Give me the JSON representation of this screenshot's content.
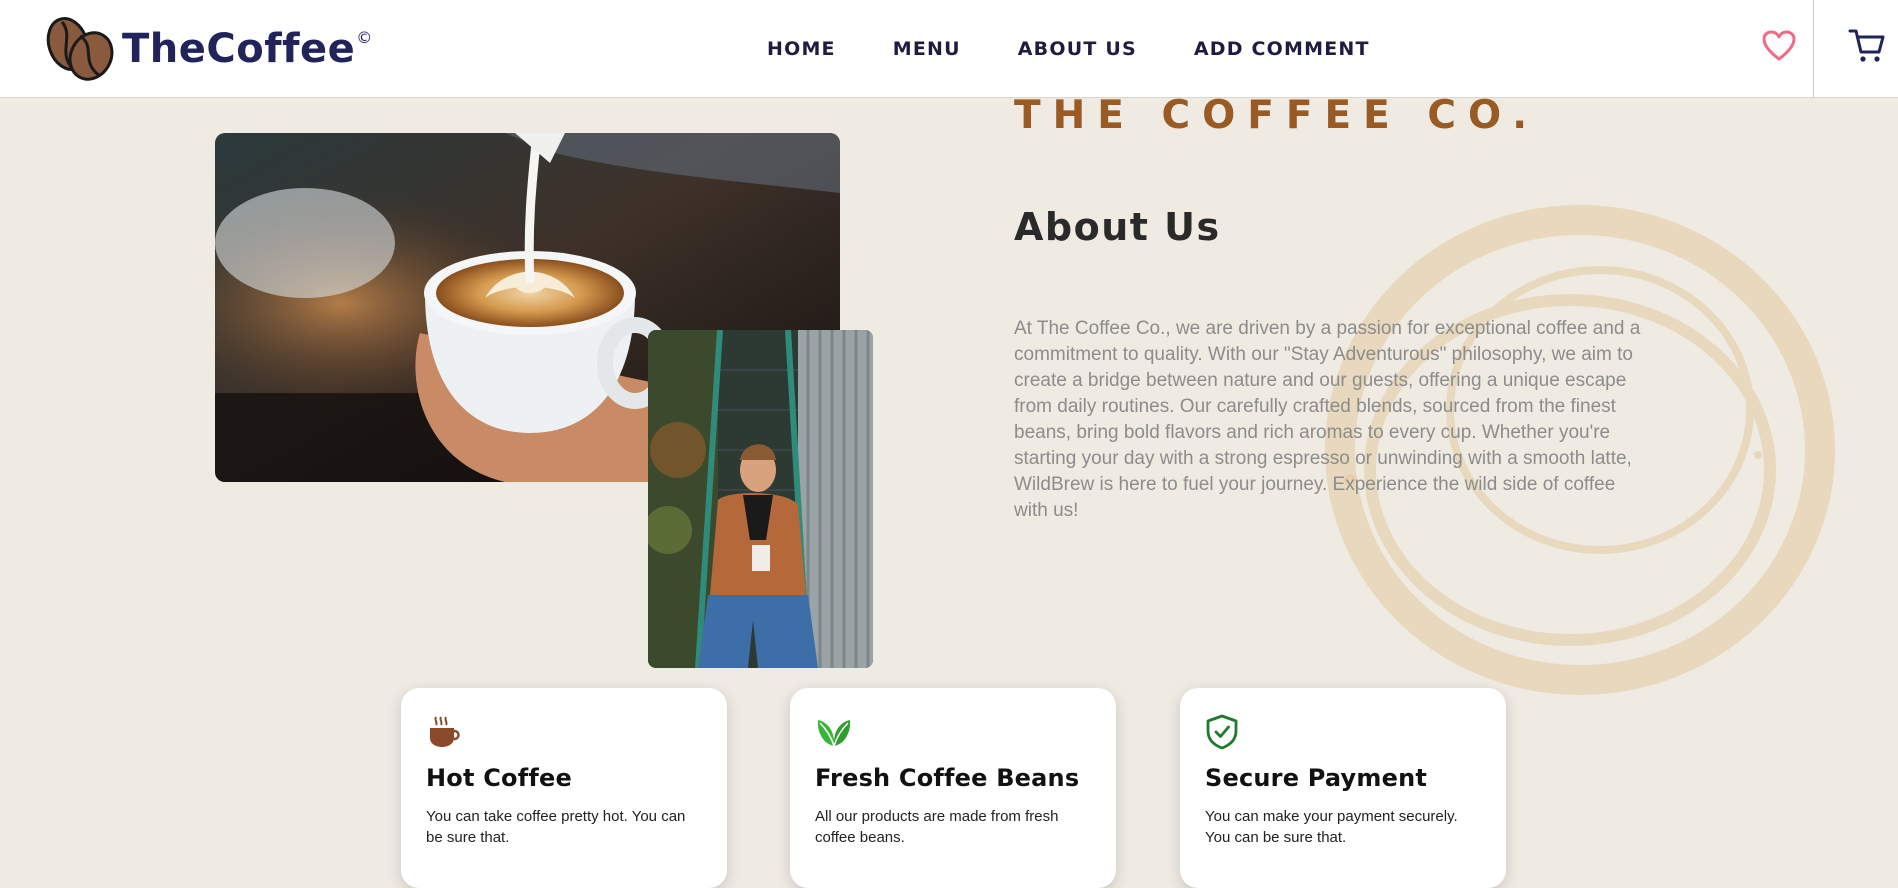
{
  "header": {
    "brand": "TheCoffee",
    "brand_mark": "©",
    "logo_icon": "coffee-beans-logo-icon",
    "nav": [
      "HOME",
      "MENU",
      "ABOUT US",
      "ADD COMMENT"
    ],
    "wishlist_icon": "heart-icon",
    "cart_icon": "cart-icon"
  },
  "about": {
    "eyebrow": "THE COFFEE CO.",
    "title": "About Us",
    "description": "At The Coffee Co., we are driven by a passion for exceptional coffee and a commitment to quality. With our \"Stay Adventurous\" philosophy, we aim to create a bridge between nature and our guests, offering a unique escape from daily routines. Our carefully crafted blends, sourced from the finest beans, bring bold flavors and rich aromas to every cup. Whether you're starting your day with a strong espresso or unwinding with a smooth latte, WildBrew is here to fuel your journey. Experience the wild side of coffee with us!"
  },
  "features": [
    {
      "icon": "hot-coffee-cup-icon",
      "title": "Hot Coffee",
      "text": "You can take coffee pretty hot. You can be sure that."
    },
    {
      "icon": "leaf-icon",
      "title": "Fresh Coffee Beans",
      "text": "All our products are made from fresh coffee beans."
    },
    {
      "icon": "shield-check-icon",
      "title": "Secure Payment",
      "text": "You can make your payment securely. You can be sure that."
    }
  ],
  "colors": {
    "background": "#efebe3",
    "brand": "#22235a",
    "accent": "#9a5a24",
    "heart": "#f06a86",
    "leaf": "#3ab53a",
    "shield": "#1f7a2e"
  }
}
